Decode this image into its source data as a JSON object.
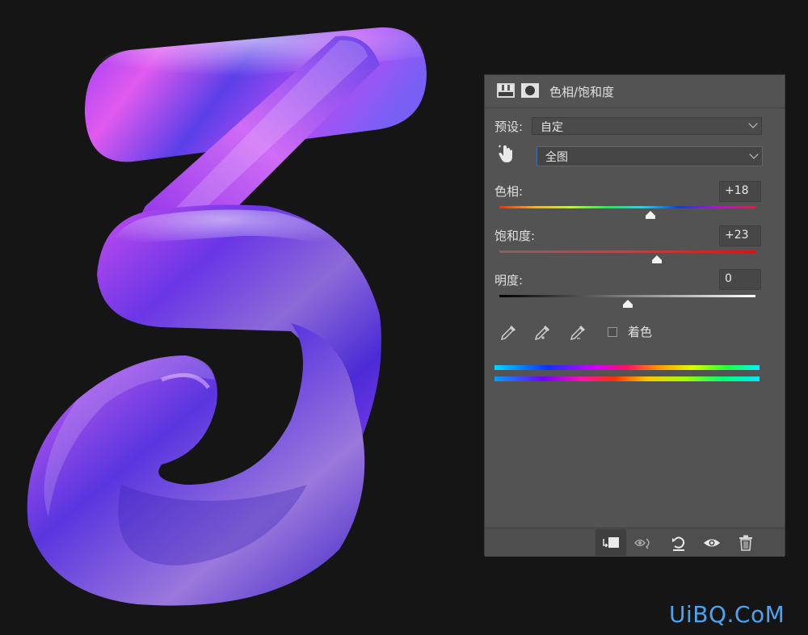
{
  "panel": {
    "title": "色相/饱和度",
    "preset_label": "预设:",
    "preset_value": "自定",
    "channel_value": "全图",
    "hue": {
      "label": "色相:",
      "value": "+18",
      "level": 0.59
    },
    "saturation": {
      "label": "饱和度:",
      "value": "+23",
      "level": 0.615
    },
    "lightness": {
      "label": "明度:",
      "value": "0",
      "level": 0.5
    },
    "colorize_label": "着色",
    "colorize_checked": false,
    "icons": {
      "header": [
        "adjustment-layer-icon",
        "layer-mask-icon"
      ],
      "tools": [
        "hand-target-icon",
        "eyedropper-icon",
        "eyedropper-add-icon",
        "eyedropper-subtract-icon"
      ],
      "footer": [
        "clip-to-layer-icon",
        "view-previous-state-icon",
        "reset-icon",
        "visibility-eye-icon",
        "trash-icon"
      ]
    }
  },
  "watermark": "UiBQ.CoM",
  "colors": {
    "panel_bg": "#535353",
    "canvas_bg": "#151515",
    "focus_blue": "#3d6ea8",
    "watermark": "#4da3f0",
    "artwork_purple": "#6a2ee0"
  }
}
